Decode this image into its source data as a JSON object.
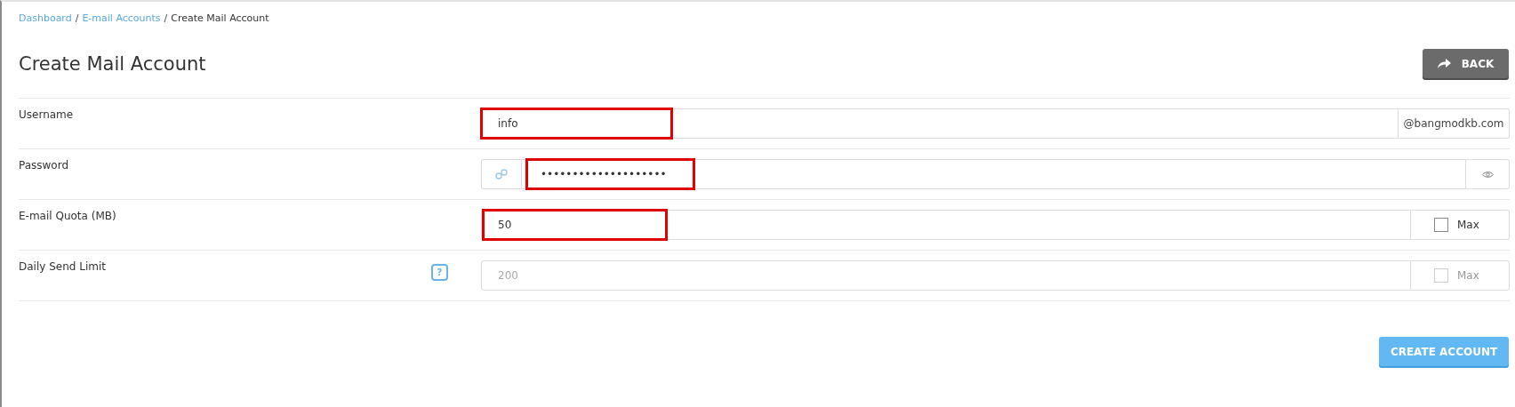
{
  "breadcrumb": [
    {
      "label": "Dashboard",
      "kind": "link"
    },
    {
      "label": "E-mail Accounts",
      "kind": "link"
    },
    {
      "label": "Create Mail Account",
      "kind": "current"
    }
  ],
  "separator": "/",
  "title": "Create Mail Account",
  "back_button": {
    "label": "BACK"
  },
  "rows": [
    {
      "label": "Username",
      "kind": "suffix",
      "value": "info",
      "suffix": "@bangmodkb.com",
      "highlighted": true
    },
    {
      "label": "Password",
      "kind": "password",
      "value": "••••••••••••••••••••",
      "highlighted": true
    },
    {
      "label": "E-mail Quota (MB)",
      "kind": "max",
      "value": "50",
      "max_label": "Max",
      "checked": false,
      "disabled": false,
      "highlighted": true
    },
    {
      "label": "Daily Send Limit",
      "kind": "max",
      "help": "?",
      "placeholder": "200",
      "max_label": "Max",
      "checked": false,
      "disabled": true,
      "highlighted": false
    }
  ],
  "create_button": {
    "label": "CREATE ACCOUNT"
  }
}
